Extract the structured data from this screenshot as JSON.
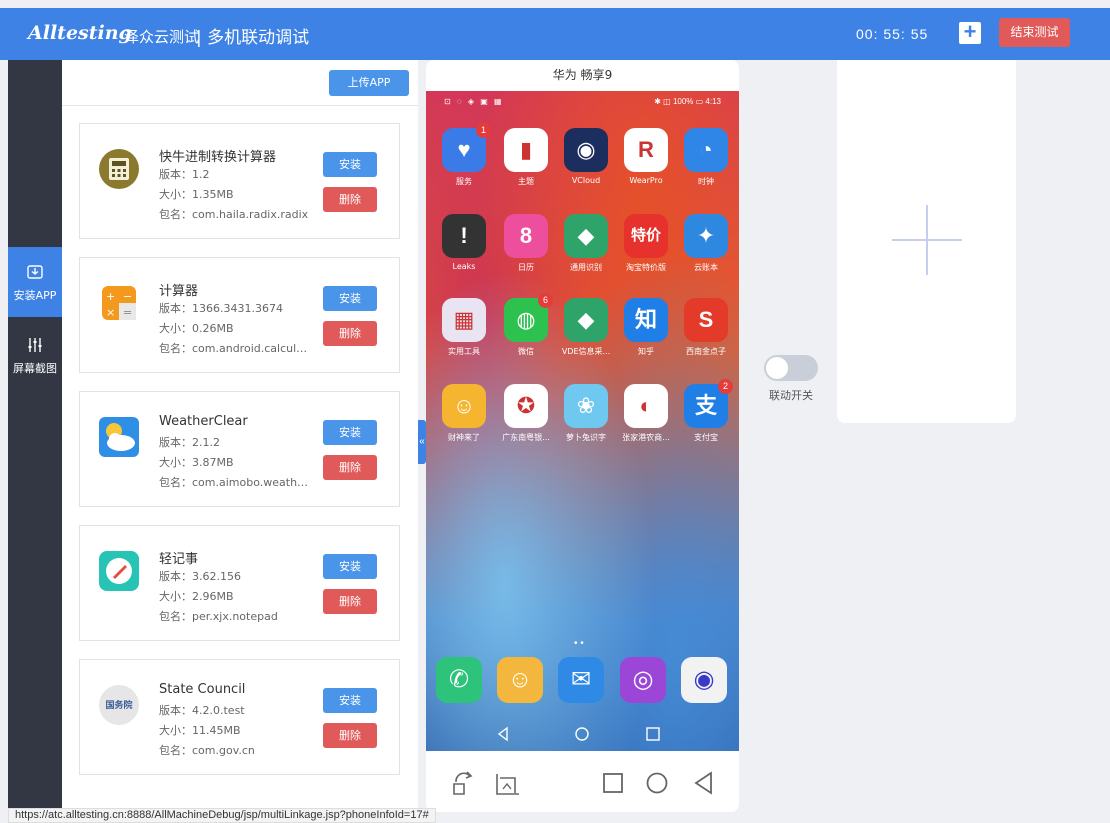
{
  "header": {
    "brand": "Alltesting",
    "brand_cn": "泽众云测试",
    "page_title": "| 多机联动调试",
    "timer": "00:  55:  55",
    "plus_label": "+",
    "end_button": "结束测试"
  },
  "sidebar": {
    "items": [
      {
        "label": "安装APP",
        "icon": "install-icon",
        "active": true
      },
      {
        "label": "屏幕截图",
        "icon": "sliders-icon",
        "active": false
      }
    ]
  },
  "app_panel": {
    "upload_button": "上传APP",
    "install_label": "安装",
    "delete_label": "删除",
    "apps": [
      {
        "name": "快牛进制转换计算器",
        "version": "版本：1.2",
        "size": "大小：1.35MB",
        "package": "包名：com.haila.radix.radix",
        "icon": "calculator-icon"
      },
      {
        "name": "计算器",
        "version": "版本：1366.3431.3674",
        "size": "大小：0.26MB",
        "package": "包名：com.android.calculat...",
        "icon": "calc-orange-icon"
      },
      {
        "name": "WeatherClear",
        "version": "版本：2.1.2",
        "size": "大小：3.87MB",
        "package": "包名：com.aimobo.weather...",
        "icon": "weather-icon"
      },
      {
        "name": "轻记事",
        "version": "版本：3.62.156",
        "size": "大小：2.96MB",
        "package": "包名：per.xjx.notepad",
        "icon": "notepad-icon"
      },
      {
        "name": "State Council",
        "version": "版本：4.2.0.test",
        "size": "大小：11.45MB",
        "package": "包名：com.gov.cn",
        "icon": "state-council-icon",
        "icon_text": "国务院"
      }
    ]
  },
  "phone": {
    "title": "华为 畅享9",
    "status_left": "⊡ ◌ ◈ ▣ ▦",
    "status_right": "✱ ◫ 100% ▭ 4:13",
    "apps": [
      {
        "label": "服务",
        "color": "#3b7be8",
        "glyph": "♥",
        "badge": "1"
      },
      {
        "label": "主题",
        "color": "#ffffff",
        "glyph": "▮",
        "badge": ""
      },
      {
        "label": "VCloud",
        "color": "#1c2e5e",
        "glyph": "◉",
        "badge": ""
      },
      {
        "label": "WearPro",
        "color": "#ffffff",
        "glyph": "R",
        "badge": ""
      },
      {
        "label": "时钟",
        "color": "#2f86e6",
        "glyph": "◔",
        "badge": ""
      },
      {
        "label": "Leaks",
        "color": "#333333",
        "glyph": "!",
        "badge": ""
      },
      {
        "label": "日历",
        "color": "#ee4f9c",
        "glyph": "8",
        "badge": ""
      },
      {
        "label": "通用识别",
        "color": "#2ea36a",
        "glyph": "◆",
        "badge": ""
      },
      {
        "label": "淘宝特价版",
        "color": "#e6312c",
        "glyph": "特价",
        "badge": ""
      },
      {
        "label": "云账本",
        "color": "#2f88e0",
        "glyph": "✦",
        "badge": ""
      },
      {
        "label": "实用工具",
        "color": "#e9e4f2",
        "glyph": "▦",
        "badge": ""
      },
      {
        "label": "微信",
        "color": "#2dc24f",
        "glyph": "◍",
        "badge": "6"
      },
      {
        "label": "VDE信息采...",
        "color": "#2ea36a",
        "glyph": "◆",
        "badge": ""
      },
      {
        "label": "知乎",
        "color": "#1f7fe6",
        "glyph": "知",
        "badge": ""
      },
      {
        "label": "西南金点子",
        "color": "#e43a2a",
        "glyph": "S",
        "badge": ""
      },
      {
        "label": "财神来了",
        "color": "#f6b52e",
        "glyph": "☺",
        "badge": ""
      },
      {
        "label": "广东南粤银...",
        "color": "#ffffff",
        "glyph": "✪",
        "badge": ""
      },
      {
        "label": "萝卜兔识字",
        "color": "#6fc8ef",
        "glyph": "❀",
        "badge": ""
      },
      {
        "label": "张家港农商...",
        "color": "#ffffff",
        "glyph": "◐",
        "badge": ""
      },
      {
        "label": "支付宝",
        "color": "#1f7fe6",
        "glyph": "支",
        "badge": "2"
      }
    ],
    "dock": [
      {
        "name": "phone",
        "color": "#2dc37a",
        "glyph": "✆"
      },
      {
        "name": "contacts",
        "color": "#f3b73e",
        "glyph": "☺"
      },
      {
        "name": "messages",
        "color": "#2f8ae6",
        "glyph": "✉"
      },
      {
        "name": "browser",
        "color": "#9b46d6",
        "glyph": "◎"
      },
      {
        "name": "camera",
        "color": "#f2f2f2",
        "glyph": "◉"
      }
    ],
    "page_dots": "• •"
  },
  "link_toggle": {
    "label": "联动开关",
    "on": false
  },
  "statusline": "https://atc.alltesting.cn:8888/AllMachineDebug/jsp/multiLinkage.jsp?phoneInfoId=17#",
  "colors": {
    "accent": "#3d82e4",
    "danger": "#e15a5a",
    "sidebar": "#333744"
  }
}
